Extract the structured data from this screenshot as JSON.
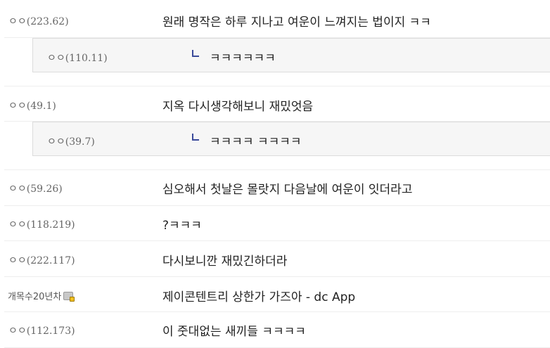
{
  "comments": [
    {
      "writer": "ㅇㅇ(223.62)",
      "text": "원래 명작은 하루 지나고 여운이 느껴지는 법이지 ㅋㅋ",
      "reply": {
        "writer": "ㅇㅇ(110.11)",
        "text": "ㅋㅋㅋㅋㅋㅋ"
      }
    },
    {
      "writer": "ㅇㅇ(49.1)",
      "text": "지옥 다시생각해보니 재밌엇음",
      "reply": {
        "writer": "ㅇㅇ(39.7)",
        "text": "ㅋㅋㅋㅋ ㅋㅋㅋㅋ"
      }
    },
    {
      "writer": "ㅇㅇ(59.26)",
      "text": "심오해서 첫날은 몰랏지 다음날에 여운이 잇더라고"
    },
    {
      "writer": "ㅇㅇ(118.219)",
      "text": "?ㅋㅋㅋ"
    },
    {
      "writer": "ㅇㅇ(222.117)",
      "text": "다시보니깐 재밌긴하더라"
    },
    {
      "writer": "개목수20년차",
      "member": true,
      "text": "제이콘텐트리 상한가 가즈아 - dc App"
    },
    {
      "writer": "ㅇㅇ(112.173)",
      "text": "이 줏대없는 새끼들 ㅋㅋㅋㅋ"
    }
  ]
}
